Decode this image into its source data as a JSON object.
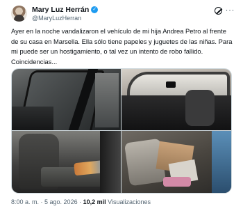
{
  "author": {
    "name": "Mary Luz Herrán",
    "handle": "@MaryLuzHerran",
    "verified_badge": "✓"
  },
  "header_icons": {
    "grok": "grok-icon",
    "more": "···"
  },
  "tweet": {
    "text": "Ayer en la noche vandalizaron el vehículo de mi hija Andrea Petro al frente de su casa en Marsella. Ella sólo tiene papeles y juguetes de las niñas. Para mi puede ser un hostigamiento, o tal vez un intento de robo fallido. Coincidencias..."
  },
  "meta": {
    "time": "8:00 a. m.",
    "separator": " · ",
    "date": "5 ago. 2026",
    "views_count": "10,2 mil",
    "views_label": "Visualizaciones"
  },
  "colors": {
    "text_primary": "#0f1419",
    "text_secondary": "#536471",
    "verified": "#1d9bf0",
    "border": "#cfd9de"
  }
}
